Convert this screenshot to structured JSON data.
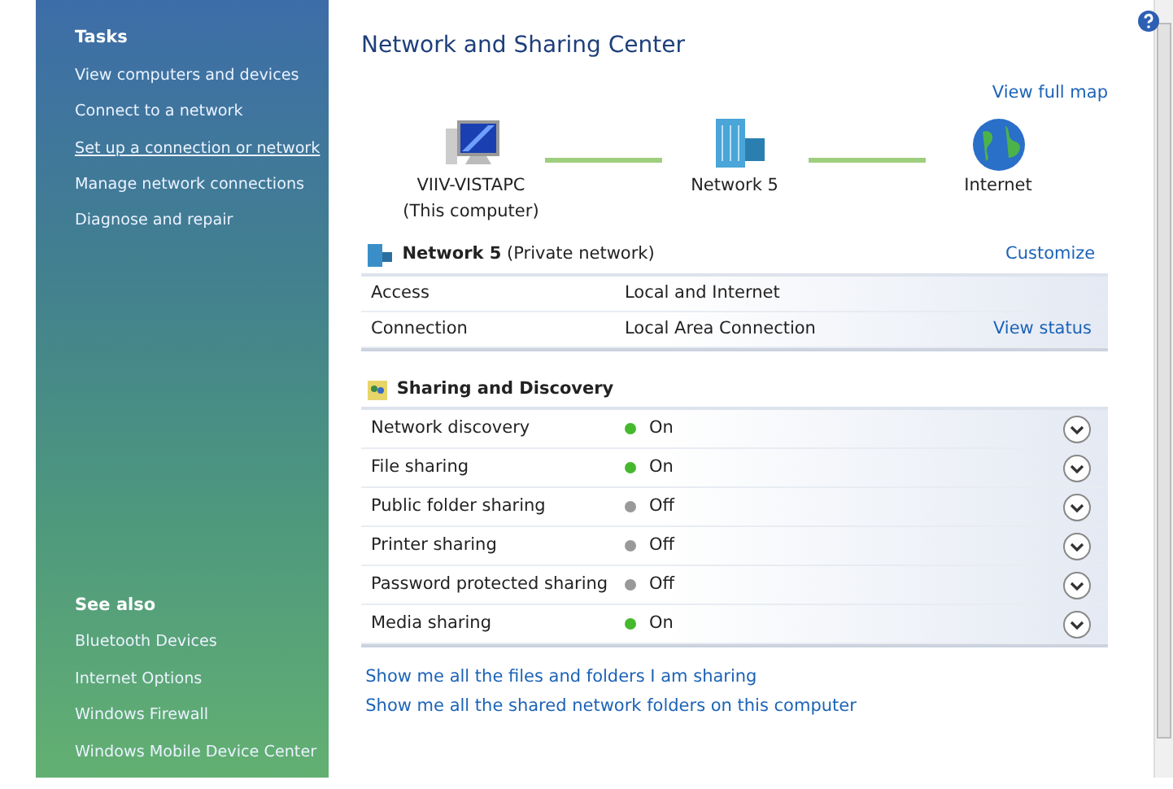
{
  "sidebar": {
    "tasks_heading": "Tasks",
    "tasks": [
      {
        "label": "View computers and devices",
        "hovered": false
      },
      {
        "label": "Connect to a network",
        "hovered": false
      },
      {
        "label": "Set up a connection or network",
        "hovered": true
      },
      {
        "label": "Manage network connections",
        "hovered": false
      },
      {
        "label": "Diagnose and repair",
        "hovered": false
      }
    ],
    "see_also_heading": "See also",
    "see_also": [
      {
        "label": "Bluetooth Devices"
      },
      {
        "label": "Internet Options"
      },
      {
        "label": "Windows Firewall"
      },
      {
        "label": "Windows Mobile Device Center"
      }
    ]
  },
  "title": "Network and Sharing Center",
  "map": {
    "link": "View full map",
    "nodes": [
      {
        "kind": "computer",
        "label": "VIIV-VISTAPC",
        "sublabel": "(This computer)"
      },
      {
        "kind": "network",
        "label": "Network  5"
      },
      {
        "kind": "internet",
        "label": "Internet"
      }
    ]
  },
  "network": {
    "name": "**Network  5** (Private network)",
    "link": "Customize",
    "rows": [
      {
        "label": "Access",
        "value": "Local and Internet"
      },
      {
        "label": "Connection",
        "value": "Local Area Connection",
        "link": "View status"
      }
    ]
  },
  "sharing": {
    "heading": "Sharing and Discovery",
    "rows": [
      {
        "label": "Network discovery",
        "status": "On",
        "on": true
      },
      {
        "label": "File sharing",
        "status": "On",
        "on": true
      },
      {
        "label": "Public folder sharing",
        "status": "Off",
        "on": false
      },
      {
        "label": "Printer sharing",
        "status": "Off",
        "on": false
      },
      {
        "label": "Password protected sharing",
        "status": "Off",
        "on": false
      },
      {
        "label": "Media sharing",
        "status": "On",
        "on": true
      }
    ]
  },
  "links": [
    "Show me all the files and folders I am sharing",
    "Show me all the shared network folders on this computer"
  ]
}
